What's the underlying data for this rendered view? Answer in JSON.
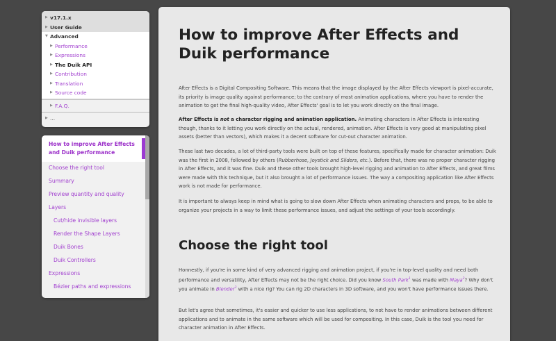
{
  "nav": {
    "version": "v17.1.x",
    "user_guide": "User Guide",
    "advanced": "Advanced",
    "performance": "Performance",
    "expressions": "Expressions",
    "duik_api": "The Duik API",
    "contribution": "Contribution",
    "translation": "Translation",
    "source_code": "Source code",
    "faq": "F.A.Q.",
    "more": "..."
  },
  "toc": {
    "items": [
      "How to improve After Effects and Duik performance",
      "Choose the right tool",
      "Summary",
      "Preview quantity and quality",
      "Layers",
      "Cut/hide invisible layers",
      "Render the Shape Layers",
      "Duik Bones",
      "Duik Controllers",
      "Expressions",
      "Bézier paths and expressions"
    ]
  },
  "article": {
    "title": "How to improve After Effects and Duik performance",
    "p1": "After Effects is a Digital Compositing Software. This means that the image displayed by the After Effects viewport is pixel-accurate, its priority is image quality against performance; to the contrary of most animation applications, where you have to render the animation to get the final high-quality video, After Effects' goal is to let you work directly on the final image.",
    "p2_bold_a": "After Effects is ",
    "p2_bold_not": "not",
    "p2_bold_b": " a character rigging and animation application.",
    "p2_rest": " Animating characters in After Effects is interesting though, thanks to it letting you work directly on the actual, rendered, animation. After Effects is very good at manipulating pixel assets (better than vectors), which makes it a decent software for cut-out character animation.",
    "p3_a": "These last two decades, a lot of third-party tools were built on top of these features, specifically made for character animation: Duik was the first in 2008, followed by others (",
    "p3_em": "Rubberhose, Joystick and Sliders, etc.",
    "p3_b": "). Before that, there was no proper character rigging in After Effects, and it was fine. Duik and these other tools brought high-level rigging and animation to After Effects, and great films were made with this technique, but it also brought a lot of performance issues. The way a compositing application like After Effects work is not made for performance.",
    "p4": "It is important to always keep in mind what is going to slow down After Effects when animating characters and props, to be able to organize your projects in a way to limit these performance issues, and adjust the settings of your tools accordingly.",
    "h2": "Choose the right tool",
    "p5_a": "Honnestly, if you're in some kind of very advanced rigging and animation project, if you're in top-level quality and need both performance and versatility, After Effects may not be the right choice. Did you know ",
    "p5_link1": "South Park",
    "p5_sup1": "1",
    "p5_b": " was made with ",
    "p5_link2": "Maya",
    "p5_sup2": "2",
    "p5_c": "? Why don't you animate in ",
    "p5_link3": "Blender",
    "p5_sup3": "3",
    "p5_d": " with a nice rig? You can rig 2D characters in 3D software, and you won't have performance issues there.",
    "p6": "But let's agree that sometimes, it's easier and quicker to use less applications, to not have to render animations between different applications and to animate in the same software which will be used for compositing. In this case, Duik is the tool you need for character animation in After Effects."
  }
}
